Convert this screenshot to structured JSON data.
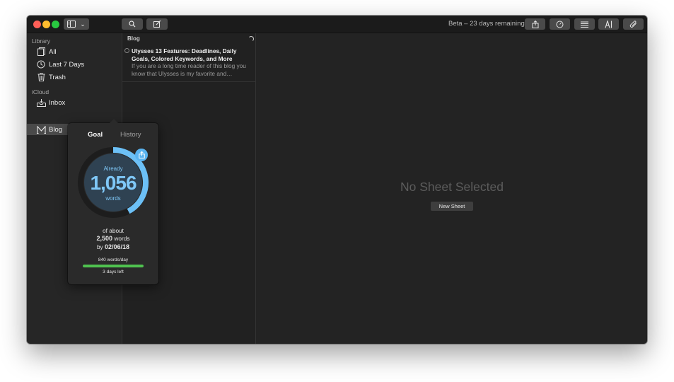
{
  "titlebar": {
    "beta_text": "Beta – 23 days remaining",
    "sidebar_toggle_caret": "⌄"
  },
  "sidebar": {
    "library_header": "Library",
    "library_items": [
      {
        "label": "All",
        "icon": "sheets-icon"
      },
      {
        "label": "Last 7 Days",
        "icon": "clock-icon"
      },
      {
        "label": "Trash",
        "icon": "trash-icon"
      }
    ],
    "icloud_header": "iCloud",
    "icloud_items": [
      {
        "label": "Inbox",
        "icon": "inbox-icon"
      },
      {
        "label": "Blog",
        "icon": "markdown-group-icon",
        "selected": true
      }
    ]
  },
  "sheet_list": {
    "header": "Blog",
    "items": [
      {
        "title": "Ulysses 13 Features: Deadlines, Daily Goals, Colored Keywords, and More",
        "excerpt": "If you are a long time reader of this blog you know that Ulysses is my favorite and…"
      }
    ]
  },
  "editor": {
    "empty_text": "No Sheet Selected",
    "new_sheet_label": "New Sheet"
  },
  "goal_popover": {
    "tab_goal": "Goal",
    "tab_history": "History",
    "already_label": "Already",
    "word_count": "1,056",
    "words_label": "words",
    "of_about": "of about",
    "goal_number": "2,500",
    "goal_unit": "words",
    "by_label": "by",
    "deadline": "02/06/18",
    "per_day": "840 words/day",
    "days_left": "3 days left",
    "progress_fraction": 0.4224,
    "daily_progress_fraction": 1.0,
    "colors": {
      "ring": "#6cc0f6",
      "ring_track": "#1d1d1d",
      "disc": "#2f4252",
      "progress": "#4fc24f"
    }
  }
}
